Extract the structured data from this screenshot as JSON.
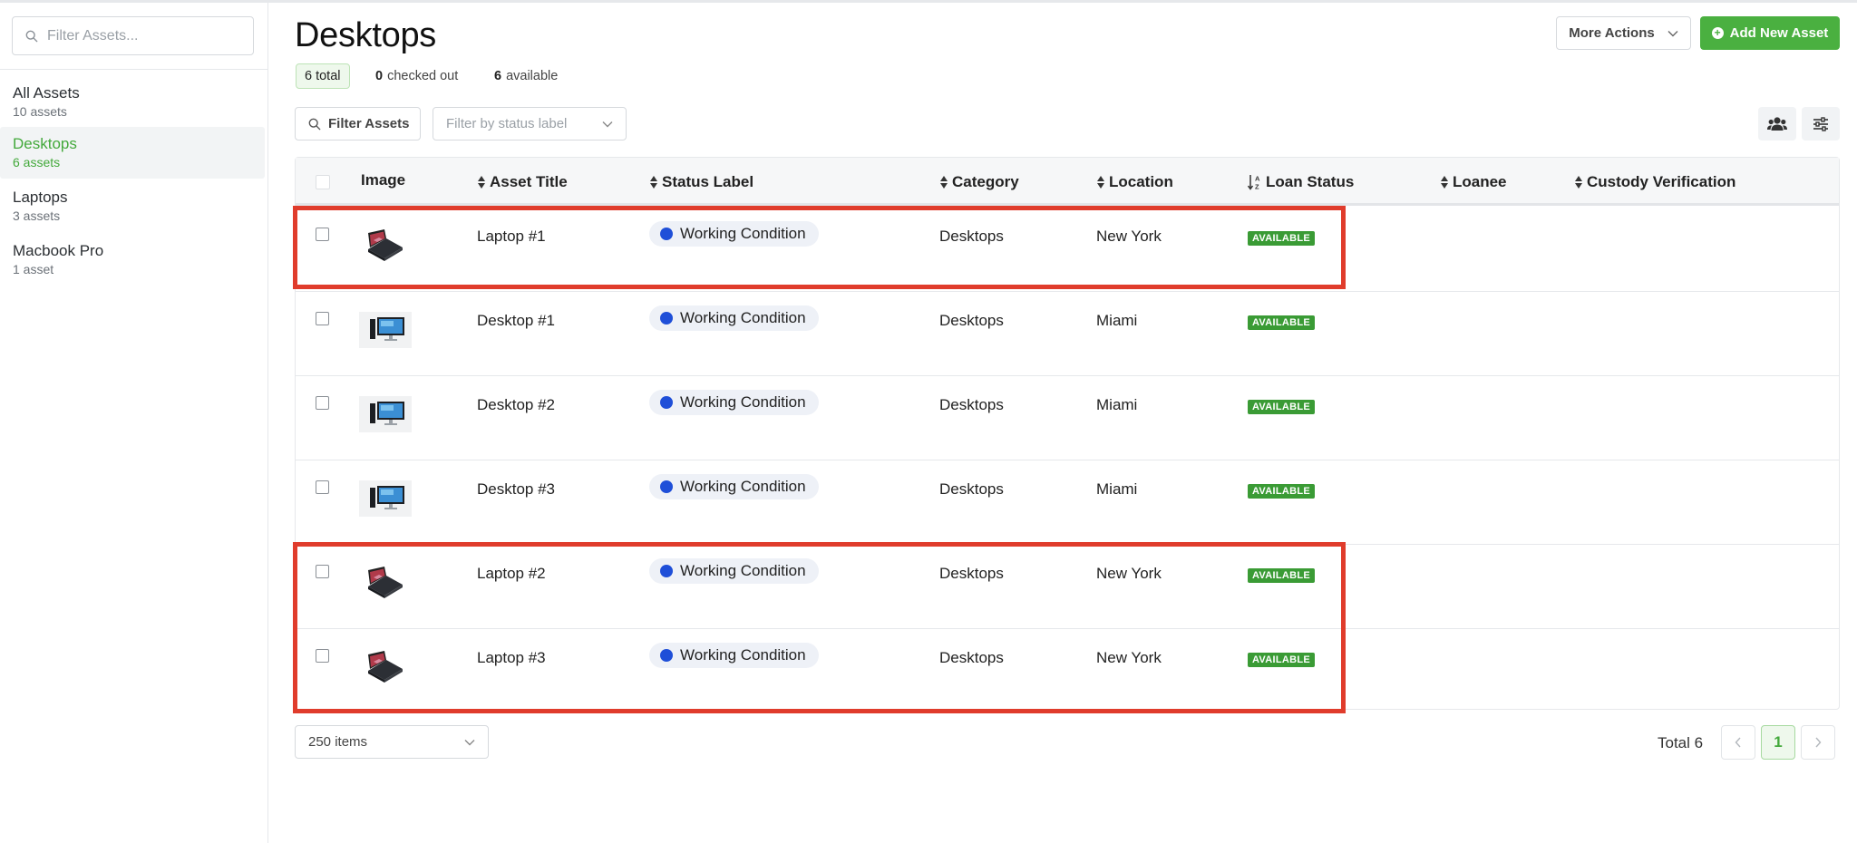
{
  "sidebar": {
    "search_placeholder": "Filter Assets...",
    "items": [
      {
        "label": "All Assets",
        "count": "10 assets",
        "active": false
      },
      {
        "label": "Desktops",
        "count": "6 assets",
        "active": true
      },
      {
        "label": "Laptops",
        "count": "3 assets",
        "active": false
      },
      {
        "label": "Macbook Pro",
        "count": "1 asset",
        "active": false
      }
    ]
  },
  "header": {
    "title": "Desktops",
    "stats": {
      "total_label": "6 total",
      "checked_out_count": "0",
      "checked_out_label": "checked out",
      "available_count": "6",
      "available_label": "available"
    },
    "more_actions_label": "More Actions",
    "add_label": "Add New Asset"
  },
  "filters": {
    "filter_button_label": "Filter Assets",
    "status_placeholder": "Filter by status label",
    "icons": [
      "users-icon",
      "sliders-icon"
    ]
  },
  "table": {
    "columns": [
      "Image",
      "Asset Title",
      "Status Label",
      "Category",
      "Location",
      "Loan Status",
      "Loanee",
      "Custody Verification"
    ],
    "rows": [
      {
        "image": "laptop",
        "title": "Laptop #1",
        "status": "Working Condition",
        "category": "Desktops",
        "location": "New York",
        "loan_status": "AVAILABLE",
        "loanee": "",
        "custody": ""
      },
      {
        "image": "desktop",
        "title": "Desktop #1",
        "status": "Working Condition",
        "category": "Desktops",
        "location": "Miami",
        "loan_status": "AVAILABLE",
        "loanee": "",
        "custody": ""
      },
      {
        "image": "desktop",
        "title": "Desktop #2",
        "status": "Working Condition",
        "category": "Desktops",
        "location": "Miami",
        "loan_status": "AVAILABLE",
        "loanee": "",
        "custody": ""
      },
      {
        "image": "desktop",
        "title": "Desktop #3",
        "status": "Working Condition",
        "category": "Desktops",
        "location": "Miami",
        "loan_status": "AVAILABLE",
        "loanee": "",
        "custody": ""
      },
      {
        "image": "laptop",
        "title": "Laptop #2",
        "status": "Working Condition",
        "category": "Desktops",
        "location": "New York",
        "loan_status": "AVAILABLE",
        "loanee": "",
        "custody": ""
      },
      {
        "image": "laptop",
        "title": "Laptop #3",
        "status": "Working Condition",
        "category": "Desktops",
        "location": "New York",
        "loan_status": "AVAILABLE",
        "loanee": "",
        "custody": ""
      }
    ],
    "status_dot_color": "#1f4fd8",
    "available_badge_color": "#3a9b35"
  },
  "footer": {
    "page_size_label": "250 items",
    "total_label": "Total 6",
    "current_page": "1"
  },
  "annotations": {
    "highlight_color": "#e03c2c"
  }
}
